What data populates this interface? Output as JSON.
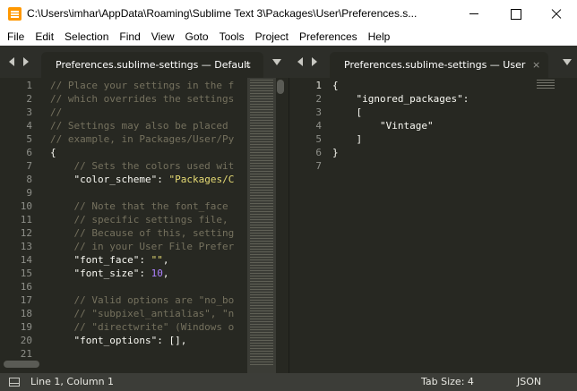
{
  "window": {
    "title": "C:\\Users\\imhar\\AppData\\Roaming\\Sublime Text 3\\Packages\\User\\Preferences.s..."
  },
  "menu": [
    "File",
    "Edit",
    "Selection",
    "Find",
    "View",
    "Goto",
    "Tools",
    "Project",
    "Preferences",
    "Help"
  ],
  "left_pane": {
    "tab_label": "Preferences.sublime-settings — Default",
    "tab_close": "×",
    "line_numbers": [
      "1",
      "2",
      "3",
      "4",
      "5",
      "6",
      "7",
      "8",
      "9",
      "10",
      "11",
      "12",
      "13",
      "14",
      "15",
      "16",
      "17",
      "18",
      "19",
      "20",
      "21"
    ],
    "lines": [
      [
        {
          "t": "// Place your settings in the f",
          "c": "comment"
        }
      ],
      [
        {
          "t": "// which overrides the settings",
          "c": "comment"
        }
      ],
      [
        {
          "t": "//",
          "c": "comment"
        }
      ],
      [
        {
          "t": "// Settings may also be placed ",
          "c": "comment"
        }
      ],
      [
        {
          "t": "// example, in Packages/User/Py",
          "c": "comment"
        }
      ],
      [
        {
          "t": "{",
          "c": "punct"
        }
      ],
      [
        {
          "t": "    // Sets the colors used wit",
          "c": "comment"
        }
      ],
      [
        {
          "t": "    ",
          "c": "punct"
        },
        {
          "t": "\"color_scheme\"",
          "c": "key"
        },
        {
          "t": ": ",
          "c": "punct"
        },
        {
          "t": "\"Packages/C",
          "c": "string"
        }
      ],
      [
        {
          "t": "",
          "c": "punct"
        }
      ],
      [
        {
          "t": "    // Note that the font_face ",
          "c": "comment"
        }
      ],
      [
        {
          "t": "    // specific settings file, ",
          "c": "comment"
        }
      ],
      [
        {
          "t": "    // Because of this, setting",
          "c": "comment"
        }
      ],
      [
        {
          "t": "    // in your User File Prefer",
          "c": "comment"
        }
      ],
      [
        {
          "t": "    ",
          "c": "punct"
        },
        {
          "t": "\"font_face\"",
          "c": "key"
        },
        {
          "t": ": ",
          "c": "punct"
        },
        {
          "t": "\"\"",
          "c": "string"
        },
        {
          "t": ",",
          "c": "punct"
        }
      ],
      [
        {
          "t": "    ",
          "c": "punct"
        },
        {
          "t": "\"font_size\"",
          "c": "key"
        },
        {
          "t": ": ",
          "c": "punct"
        },
        {
          "t": "10",
          "c": "num"
        },
        {
          "t": ",",
          "c": "punct"
        }
      ],
      [
        {
          "t": "",
          "c": "punct"
        }
      ],
      [
        {
          "t": "    // Valid options are \"no_bo",
          "c": "comment"
        }
      ],
      [
        {
          "t": "    // \"subpixel_antialias\", \"n",
          "c": "comment"
        }
      ],
      [
        {
          "t": "    // \"directwrite\" (Windows o",
          "c": "comment"
        }
      ],
      [
        {
          "t": "    ",
          "c": "punct"
        },
        {
          "t": "\"font_options\"",
          "c": "key"
        },
        {
          "t": ": [],",
          "c": "punct"
        }
      ],
      [
        {
          "t": "",
          "c": "punct"
        }
      ]
    ]
  },
  "right_pane": {
    "tab_label": "Preferences.sublime-settings — User",
    "tab_close": "×",
    "line_numbers": [
      "1",
      "2",
      "3",
      "4",
      "5",
      "6",
      "7"
    ],
    "lines": [
      [
        {
          "t": "{",
          "c": "punct"
        }
      ],
      [
        {
          "t": "    ",
          "c": "punct"
        },
        {
          "t": "\"ignored_packages\"",
          "c": "key"
        },
        {
          "t": ":",
          "c": "punct"
        }
      ],
      [
        {
          "t": "    [",
          "c": "punct"
        }
      ],
      [
        {
          "t": "        ",
          "c": "punct"
        },
        {
          "t": "\"Vintage\"",
          "c": "key"
        }
      ],
      [
        {
          "t": "    ]",
          "c": "punct"
        }
      ],
      [
        {
          "t": "}",
          "c": "punct"
        }
      ],
      [
        {
          "t": "",
          "c": "punct"
        }
      ]
    ]
  },
  "status": {
    "position": "Line 1, Column 1",
    "tab_size": "Tab Size: 4",
    "syntax": "JSON"
  },
  "colors": {
    "editor_bg": "#272822",
    "comment": "#75715e",
    "string": "#e6db74",
    "number": "#ae81ff",
    "foreground": "#f8f8f2"
  }
}
